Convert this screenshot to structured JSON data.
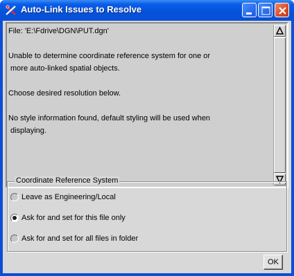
{
  "window": {
    "title": "Auto-Link Issues to Resolve",
    "app_icon": "scissors-x-icon",
    "controls": {
      "minimize_icon": "minimize-icon",
      "maximize_icon": "maximize-icon",
      "close_icon": "close-icon"
    }
  },
  "message": {
    "lines": [
      "File: 'E:\\Fdrive\\DGN\\PUT.dgn'",
      "",
      "Unable to determine coordinate reference system for one or",
      " more auto-linked spatial objects.",
      "",
      "Choose desired resolution below.",
      "",
      "No style information found, default styling will be used when",
      " displaying."
    ]
  },
  "crs_group": {
    "legend": "Coordinate Reference System",
    "options": [
      {
        "label": "Leave as Engineering/Local",
        "selected": false
      },
      {
        "label": "Ask for and set for this file only",
        "selected": true
      },
      {
        "label": "Ask for and set for all files in folder",
        "selected": false
      }
    ]
  },
  "buttons": {
    "ok_label": "OK"
  },
  "colors": {
    "titlebar": "#0a4fd6",
    "close_button": "#de4b23",
    "dialog_background": "#d8d8d8"
  }
}
